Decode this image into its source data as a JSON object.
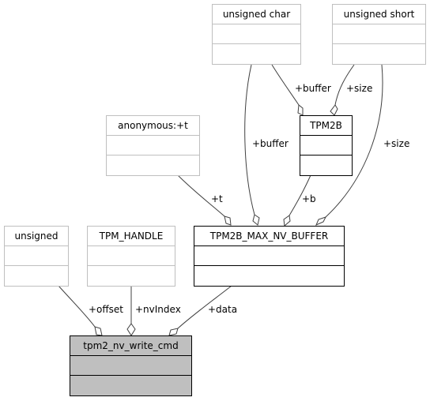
{
  "diagram": {
    "type": "collaboration",
    "nodes": {
      "unsigned_char": {
        "name": "unsigned char"
      },
      "unsigned_short": {
        "name": "unsigned short"
      },
      "tpm2b": {
        "name": "TPM2B"
      },
      "anonymous_t": {
        "name": "anonymous:+t"
      },
      "unsigned": {
        "name": "unsigned"
      },
      "tpm_handle": {
        "name": "TPM_HANDLE"
      },
      "tpm2b_max_nv_buffer": {
        "name": "TPM2B_MAX_NV_BUFFER"
      },
      "tpm2_nv_write_cmd": {
        "name": "tpm2_nv_write_cmd"
      }
    },
    "edges": [
      {
        "from": "unsigned_char",
        "to": "tpm2b",
        "label": "+buffer"
      },
      {
        "from": "unsigned_short",
        "to": "tpm2b",
        "label": "+size"
      },
      {
        "from": "unsigned_char",
        "to": "tpm2b_max_nv_buffer",
        "label": "+buffer"
      },
      {
        "from": "unsigned_short",
        "to": "tpm2b_max_nv_buffer",
        "label": "+size"
      },
      {
        "from": "tpm2b",
        "to": "tpm2b_max_nv_buffer",
        "label": "+b"
      },
      {
        "from": "anonymous_t",
        "to": "tpm2b_max_nv_buffer",
        "label": "+t"
      },
      {
        "from": "unsigned",
        "to": "tpm2_nv_write_cmd",
        "label": "+offset"
      },
      {
        "from": "tpm_handle",
        "to": "tpm2_nv_write_cmd",
        "label": "+nvIndex"
      },
      {
        "from": "tpm2b_max_nv_buffer",
        "to": "tpm2_nv_write_cmd",
        "label": "+data"
      }
    ],
    "colors": {
      "edge": "#404040",
      "grey_border": "#bfbfbf",
      "focus_fill": "#bfbfbf"
    }
  }
}
